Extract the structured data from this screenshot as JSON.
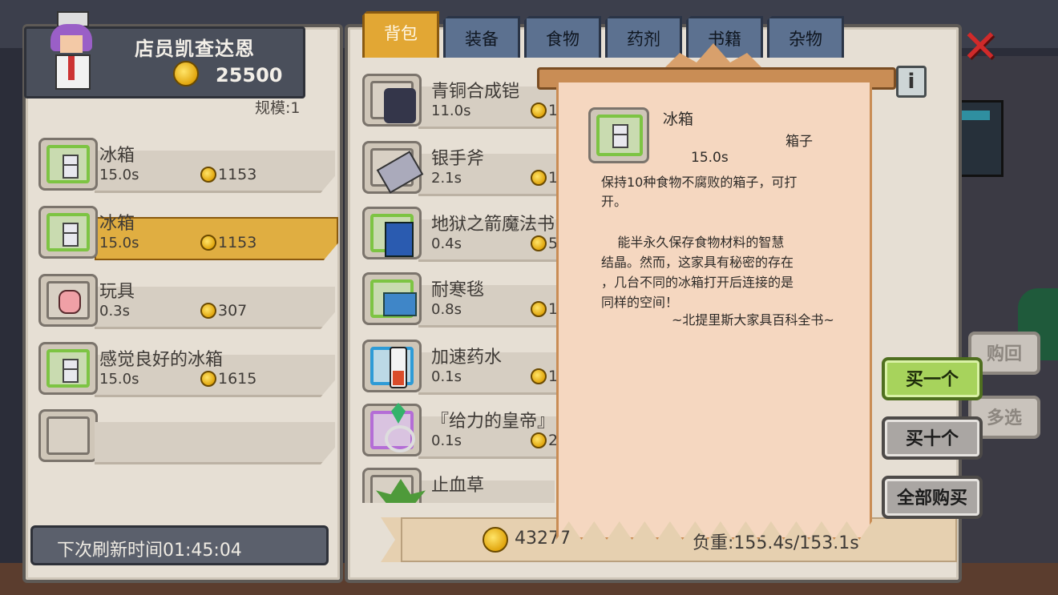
{
  "shopkeeper": {
    "name": "店员凯查达恩",
    "gold": "25500",
    "scale": "规模:1"
  },
  "shop_items": [
    {
      "name": "冰箱",
      "time": "15.0s",
      "price": "1153",
      "icon": "fridge-icon",
      "frame": "green",
      "selected": false
    },
    {
      "name": "冰箱",
      "time": "15.0s",
      "price": "1153",
      "icon": "fridge-icon",
      "frame": "green",
      "selected": true
    },
    {
      "name": "玩具",
      "time": "0.3s",
      "price": "307",
      "icon": "teddy-bear-icon",
      "frame": "plain",
      "selected": false
    },
    {
      "name": "感觉良好的冰箱",
      "time": "15.0s",
      "price": "1615",
      "icon": "fridge-icon",
      "frame": "green",
      "selected": false
    }
  ],
  "refresh_text": "下次刷新时间01:45:04",
  "tabs": [
    "背包",
    "装备",
    "食物",
    "药剂",
    "书籍",
    "杂物"
  ],
  "active_tab": "背包",
  "inventory_items": [
    {
      "name": "青铜合成铠",
      "time": "11.0s",
      "price": "1",
      "icon": "bronze-armor-icon"
    },
    {
      "name": "银手斧",
      "time": "2.1s",
      "price": "1",
      "icon": "silver-axe-icon"
    },
    {
      "name": "地狱之箭魔法书",
      "visible_name": "地狱之箭魔法书",
      "time": "0.4s",
      "price": "5",
      "icon": "spellbook-icon"
    },
    {
      "name": "耐寒毯",
      "time": "0.8s",
      "price": "1",
      "icon": "blanket-icon"
    },
    {
      "name": "加速药水",
      "time": "0.1s",
      "price": "1",
      "icon": "potion-icon"
    },
    {
      "name": "『给力的皇帝』",
      "time": "0.1s",
      "price": "2",
      "icon": "ring-icon"
    },
    {
      "name": "止血草",
      "time": "",
      "price": "",
      "icon": "herb-icon"
    }
  ],
  "footer": {
    "gold": "43277",
    "weight": "负重:155.4s/153.1s"
  },
  "tooltip": {
    "name": "冰箱",
    "type": "箱子",
    "time": "15.0s",
    "description": "保持10种食物不腐败的箱子，可打\n开。",
    "lore": "    能半永久保存食物材料的智慧\n结晶。然而，这家具有秘密的存在\n，几台不同的冰箱打开后连接的是\n同样的空间！",
    "source": "~北提里斯大家具百科全书~"
  },
  "buttons": {
    "buy_one": "买一个",
    "buy_ten": "买十个",
    "buy_all": "全部购买",
    "buy_back": "购回",
    "multi_select": "多选"
  },
  "close_label": "✕",
  "info_label": "i",
  "colors": {
    "accent": "#e0ae41",
    "green_frame": "#7dc443",
    "close": "#d02a2a"
  }
}
